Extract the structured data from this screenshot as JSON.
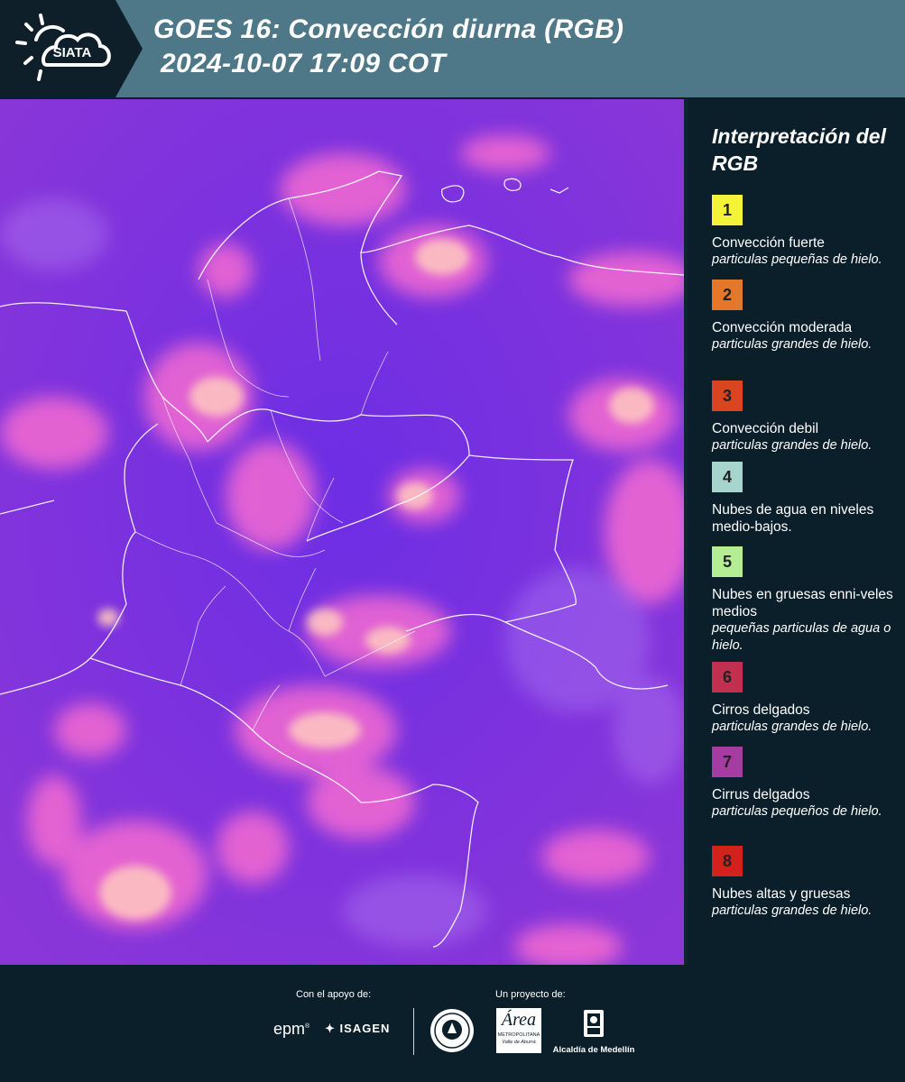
{
  "header": {
    "logo_text": "SIATA",
    "title_line1": "GOES 16: Convección diurna (RGB)",
    "title_line2": "2024-10-07 17:09 COT"
  },
  "map": {
    "background_color": "#7a2fe0",
    "cloud_color": "#ff6fd0",
    "convective_core_color": "#ffc9c0",
    "boundary_color": "#ffffff"
  },
  "legend": {
    "title": "Interpretación del RGB",
    "items": [
      {
        "number": "1",
        "color": "#f3f43a",
        "name": "Convección fuerte",
        "desc": "particulas pequeñas de hielo."
      },
      {
        "number": "2",
        "color": "#e4772a",
        "name": "Convección moderada",
        "desc": "particulas grandes de hielo."
      },
      {
        "number": "3",
        "color": "#d9451f",
        "name": "Convección debil",
        "desc": "particulas grandes de hielo."
      },
      {
        "number": "4",
        "color": "#a8d4ce",
        "name": "Nubes de agua en niveles medio-bajos.",
        "desc": ""
      },
      {
        "number": "5",
        "color": "#b5ee92",
        "name": "Nubes en gruesas enni-veles medios",
        "desc": "pequeñas particulas de agua o hielo."
      },
      {
        "number": "6",
        "color": "#c1304e",
        "name": "Cirros delgados",
        "desc": "particulas grandes de hielo."
      },
      {
        "number": "7",
        "color": "#a63ca2",
        "name": "Cirrus delgados",
        "desc": "particulas pequeños de hielo."
      },
      {
        "number": "8",
        "color": "#d3221b",
        "name": "Nubes altas y gruesas",
        "desc": "particulas grandes de hielo."
      }
    ]
  },
  "footer": {
    "support_label": "Con el apoyo de:",
    "project_label": "Un proyecto de:",
    "sponsors": [
      "epm",
      "ISAGEN"
    ],
    "partner_area_name": "Área",
    "partner_area_sub1": "METROPOLITANA",
    "partner_area_sub2": "Valle de Aburrá",
    "partner_alcaldia": "Alcaldía de Medellín"
  }
}
